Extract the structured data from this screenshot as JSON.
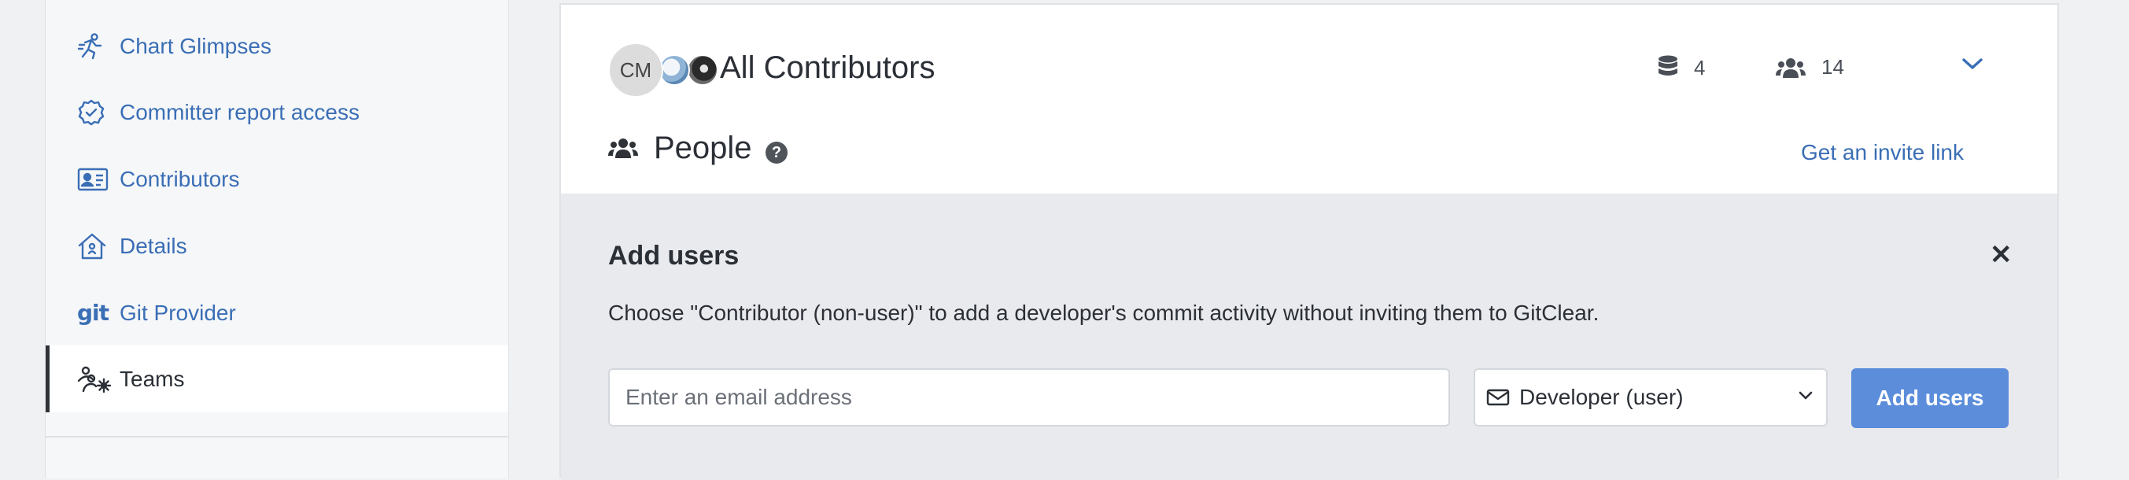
{
  "sidebar": {
    "items": [
      {
        "label": "Chart Glimpses",
        "icon": "running-person-icon"
      },
      {
        "label": "Committer report access",
        "icon": "badge-check-icon"
      },
      {
        "label": "Contributors",
        "icon": "id-card-icon"
      },
      {
        "label": "Details",
        "icon": "house-icon"
      },
      {
        "label": "Git Provider",
        "icon": "git-icon",
        "icon_text": "git"
      },
      {
        "label": "Teams",
        "icon": "users-gear-icon",
        "active": true
      }
    ]
  },
  "team": {
    "avatar_initials": "CM",
    "title": "All Contributors",
    "repos_count": "4",
    "members_count": "14"
  },
  "people": {
    "heading": "People",
    "help_symbol": "?",
    "invite_link": "Get an invite link"
  },
  "add_users": {
    "title": "Add users",
    "close_symbol": "✕",
    "description": "Choose \"Contributor (non-user)\" to add a developer's commit activity without inviting them to GitClear.",
    "email_placeholder": "Enter an email address",
    "role_selected": "Developer (user)",
    "submit_label": "Add users"
  },
  "colors": {
    "link": "#3a6eb5",
    "button": "#5b8ddb",
    "panel_bg": "#e9eaed"
  }
}
